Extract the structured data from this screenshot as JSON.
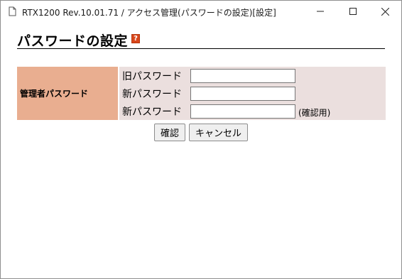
{
  "window": {
    "title": "RTX1200 Rev.10.01.71 / アクセス管理(パスワードの設定)[設定]",
    "icon": "document-icon",
    "controls": [
      "minimize-icon",
      "maximize-icon",
      "close-icon"
    ]
  },
  "page": {
    "title": "パスワードの設定",
    "help_icon_glyph": "?"
  },
  "form": {
    "section_label": "管理者パスワード",
    "fields": [
      {
        "label": "旧パスワード",
        "value": ""
      },
      {
        "label": "新パスワード",
        "value": ""
      },
      {
        "label": "新パスワード",
        "value": "",
        "note": "(確認用)"
      }
    ]
  },
  "buttons": {
    "confirm_label": "確認",
    "cancel_label": "キャンセル"
  },
  "colors": {
    "label_bg": "#e9ae90",
    "field_bg": "#ebdfde",
    "help_icon": "#d9461b"
  }
}
